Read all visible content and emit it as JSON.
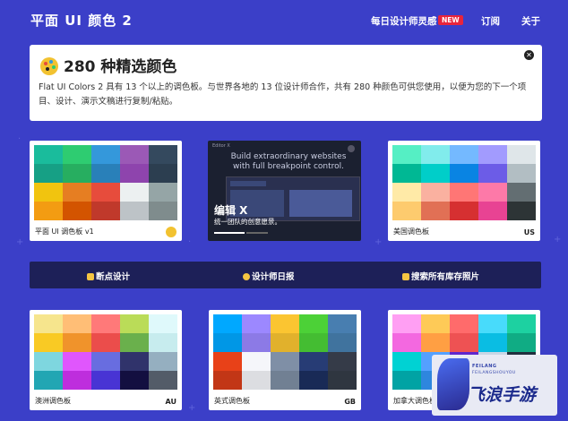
{
  "header": {
    "brand": "平面 UI 颜色 2",
    "nav_inspo": "每日设计师灵感",
    "nav_badge": "NEW",
    "nav_subscribe": "订阅",
    "nav_about": "关于"
  },
  "banner": {
    "title": "280 种精选颜色",
    "text": "Flat UI Colors 2 具有 13 个以上的调色板。与世界各地的 13 位设计师合作，共有 280 种颜色可供您使用，以便为您的下一个项目、设计、演示文稿进行复制/粘贴。"
  },
  "cards": [
    {
      "label": "平面 UI 调色板 v1",
      "code": "",
      "colors": [
        "#1abc9c",
        "#2ecc71",
        "#3498db",
        "#9b59b6",
        "#34495e",
        "#16a085",
        "#27ae60",
        "#2980b9",
        "#8e44ad",
        "#2c3e50",
        "#f1c40f",
        "#e67e22",
        "#e74c3c",
        "#ecf0f1",
        "#95a5a6",
        "#f39c12",
        "#d35400",
        "#c0392b",
        "#bdc3c7",
        "#7f8c8d"
      ]
    },
    {
      "label": "美国调色板",
      "code": "US",
      "colors": [
        "#55efc4",
        "#81ecec",
        "#74b9ff",
        "#a29bfe",
        "#dfe6e9",
        "#00b894",
        "#00cec9",
        "#0984e3",
        "#6c5ce7",
        "#b2bec3",
        "#ffeaa7",
        "#fab1a0",
        "#ff7675",
        "#fd79a8",
        "#636e72",
        "#fdcb6e",
        "#e17055",
        "#d63031",
        "#e84393",
        "#2d3436"
      ]
    },
    {
      "label": "澳洲调色板",
      "code": "AU",
      "colors": [
        "#f6e58d",
        "#ffbe76",
        "#ff7979",
        "#badc58",
        "#dff9fb",
        "#f9ca24",
        "#f0932b",
        "#eb4d4b",
        "#6ab04c",
        "#c7ecee",
        "#7ed6df",
        "#e056fd",
        "#686de0",
        "#30336b",
        "#95afc0",
        "#22a6b3",
        "#be2edd",
        "#4834d4",
        "#130f40",
        "#535c68"
      ]
    },
    {
      "label": "英式调色板",
      "code": "GB",
      "colors": [
        "#00a8ff",
        "#9c88ff",
        "#fbc531",
        "#4cd137",
        "#487eb0",
        "#0097e6",
        "#8c7ae6",
        "#e1b12c",
        "#44bd32",
        "#40739e",
        "#e84118",
        "#f5f6fa",
        "#7f8fa6",
        "#273c75",
        "#353b48",
        "#c23616",
        "#dcdde1",
        "#718093",
        "#192a56",
        "#2f3640"
      ]
    },
    {
      "label": "加拿大调色板",
      "code": "",
      "colors": [
        "#ff9ff3",
        "#feca57",
        "#ff6b6b",
        "#48dbfb",
        "#1dd1a1",
        "#f368e0",
        "#ff9f43",
        "#ee5253",
        "#0abde3",
        "#10ac84",
        "#00d2d3",
        "#54a0ff",
        "#5f27cd",
        "#c8d6e5",
        "#222f3e",
        "#01a3a4",
        "#2e86de",
        "#341f97",
        "#8395a7",
        "#576574"
      ]
    }
  ],
  "ad": {
    "brand": "Editor X",
    "headline": "Build extraordinary websites with full breakpoint control.",
    "title": "编辑 X",
    "subtitle": "统一团队的创意愿景。"
  },
  "strip": {
    "link1": "断点设计",
    "link2": "设计师日报",
    "link3": "搜索所有库存照片"
  },
  "watermark": {
    "small1": "FEILANG",
    "small2": "FEILANGSHOUYOU",
    "big": "飞浪手游"
  }
}
